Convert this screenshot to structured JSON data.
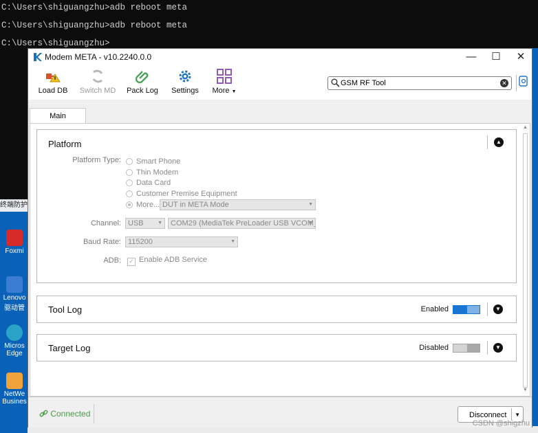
{
  "console": {
    "lines": [
      "C:\\Users\\shiguangzhu>adb reboot meta",
      "C:\\Users\\shiguangzhu>adb reboot meta",
      "C:\\Users\\shiguangzhu>"
    ]
  },
  "desktop": {
    "banner": "终端防护",
    "icons": [
      {
        "label": "Foxmi"
      },
      {
        "label": "Lenovo 驱动管"
      },
      {
        "label": "Micros Edge"
      },
      {
        "label": "NetWe Busines"
      }
    ]
  },
  "window": {
    "title": "Modem META - v10.2240.0.0",
    "controls": {
      "minimize": "—",
      "maximize": "☐",
      "close": "✕"
    }
  },
  "toolbar": {
    "items": [
      {
        "label": "Load DB",
        "icon": "load-db-icon",
        "enabled": true
      },
      {
        "label": "Switch MD",
        "icon": "switch-md-icon",
        "enabled": false
      },
      {
        "label": "Pack Log",
        "icon": "paperclip-icon",
        "enabled": true
      },
      {
        "label": "Settings",
        "icon": "gear-icon",
        "enabled": true
      },
      {
        "label": "More",
        "icon": "grid-icon",
        "enabled": true
      }
    ],
    "search_value": "GSM RF Tool"
  },
  "tabs": [
    {
      "label": "Main"
    }
  ],
  "platform": {
    "title": "Platform",
    "type_label": "Platform Type:",
    "options": [
      "Smart Phone",
      "Thin Modem",
      "Data Card",
      "Customer Premise Equipment",
      "More..."
    ],
    "selected": "More...",
    "more_combo": "DUT in META Mode",
    "channel_label": "Channel:",
    "channel_value": "USB",
    "port_value": "COM29  (MediaTek PreLoader USB VCOM_!",
    "baud_label": "Baud Rate:",
    "baud_value": "115200",
    "adb_label": "ADB:",
    "adb_checkbox": "Enable ADB Service",
    "adb_checked": true
  },
  "tool_log": {
    "title": "Tool Log",
    "state": "Enabled",
    "on": true
  },
  "target_log": {
    "title": "Target Log",
    "state": "Disabled",
    "on": false
  },
  "status": {
    "connection": "Connected",
    "disconnect_label": "Disconnect"
  },
  "watermark": "CSDN @shigzhu",
  "colors": {
    "accent": "#1974d2",
    "connected": "#4a9a4a",
    "desktop": "#0a62b8"
  }
}
